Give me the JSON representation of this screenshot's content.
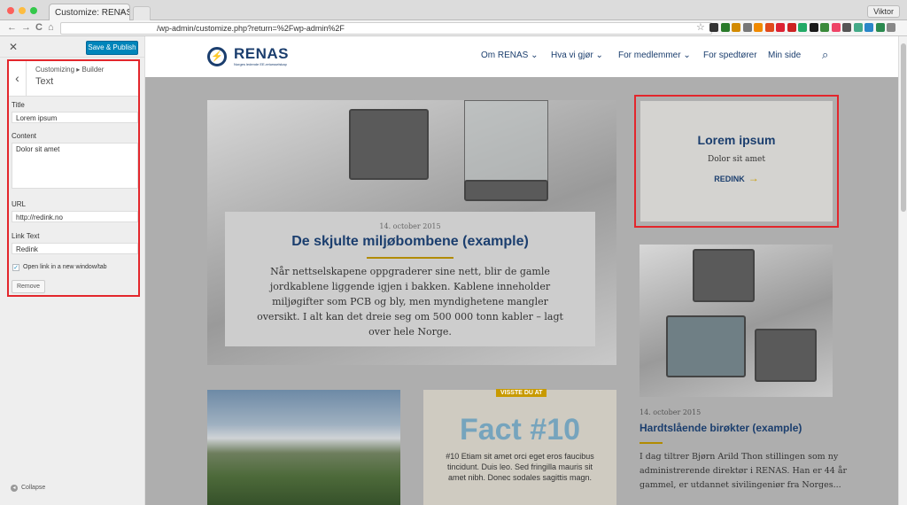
{
  "browser": {
    "tab_title": "Customize: RENAS AS",
    "tab_close": "×",
    "user": "Viktor",
    "url": "/wp-admin/customize.php?return=%2Fwp-admin%2F",
    "back": "←",
    "forward": "→",
    "reload": "C",
    "home": "⌂",
    "star": "☆",
    "extension_colors": [
      "#333",
      "#2a7a2a",
      "#d28a00",
      "#777",
      "#f08a00",
      "#e04a1c",
      "#d23",
      "#c22",
      "#2a6",
      "#1a1a1a",
      "#3a8a3a",
      "#e46",
      "#555",
      "#4a8",
      "#2a86c8",
      "#2b8a4f",
      "#888"
    ]
  },
  "customizer": {
    "close_icon": "✕",
    "save_label": "Save & Publish",
    "breadcrumb": "Customizing ▸ Builder",
    "panel_title": "Text",
    "back_icon": "‹",
    "fields": {
      "title_label": "Title",
      "title_value": "Lorem ipsum",
      "content_label": "Content",
      "content_value": "Dolor sit amet",
      "url_label": "URL",
      "url_value": "http://redink.no",
      "link_text_label": "Link Text",
      "link_text_value": "Redink",
      "new_window_label": "Open link in a new window/tab",
      "new_window_checked": "✓"
    },
    "remove_label": "Remove",
    "collapse_label": "Collapse",
    "collapse_icon": "◂"
  },
  "site": {
    "logo_name": "RENAS",
    "logo_tagline": "Norges ledende EE-retursselskap",
    "logo_glyph": "⚡",
    "nav": [
      "Om RENAS ⌄",
      "Hva vi gjør ⌄",
      "For medlemmer ⌄",
      "For spedtører",
      "Min side"
    ],
    "search_icon": "⌕",
    "article1": {
      "date": "14. october 2015",
      "title": "De skjulte miljøbombene (example)",
      "body": "Når nettselskapene oppgraderer sine nett, blir de gamle jordkablene liggende igjen i bakken. Kablene inneholder miljøgifter som PCB og bly, men myndighetene mangler oversikt. I alt kan det dreie seg om 500 000 tonn kabler – lagt over hele Norge."
    },
    "widget": {
      "title": "Lorem ipsum",
      "body": "Dolor sit amet",
      "link": "REDINK",
      "arrow": "→"
    },
    "fact": {
      "badge": "VISSTE DU AT",
      "title": "Fact #10",
      "body": "#10 Etiam sit amet orci eget eros faucibus tincidunt. Duis leo. Sed fringilla mauris sit amet nibh. Donec sodales sagittis magn."
    },
    "article2": {
      "date": "14. october 2015",
      "title": "Hardtslående birøkter (example)",
      "body": "I dag tiltrer Bjørn Arild Thon stillingen som ny administrerende direktør i RENAS. Han er 44 år gammel, er utdannet sivilingeniør fra Norges..."
    }
  }
}
